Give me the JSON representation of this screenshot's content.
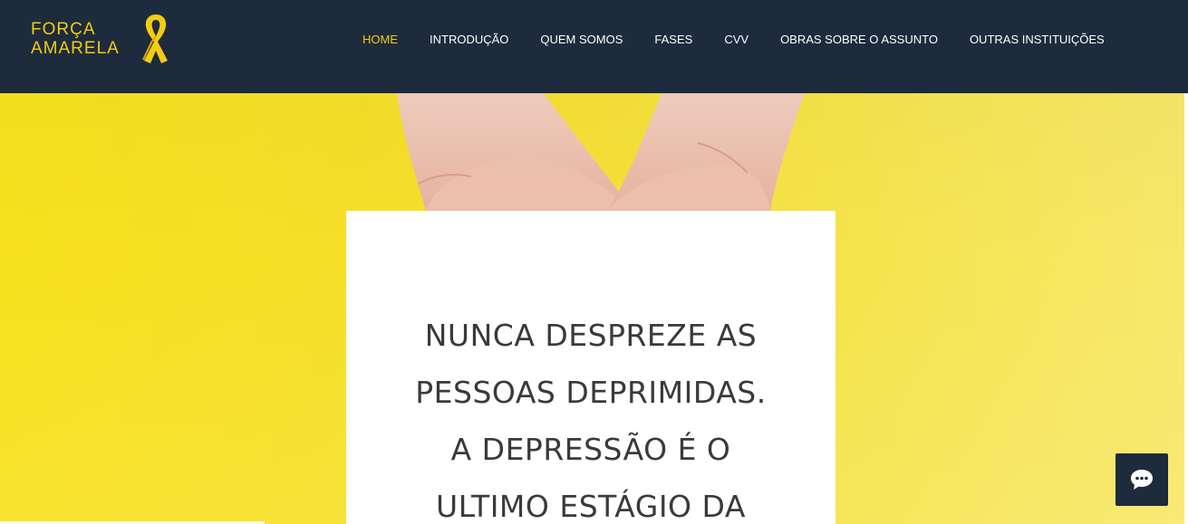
{
  "site": {
    "logo_line1": "FORÇA",
    "logo_line2": "AMARELA",
    "logo_icon": "yellow-ribbon-icon"
  },
  "nav": {
    "items": [
      {
        "label": "HOME",
        "active": true
      },
      {
        "label": "INTRODUÇÃO",
        "active": false
      },
      {
        "label": "QUEM SOMOS",
        "active": false
      },
      {
        "label": "FASES",
        "active": false
      },
      {
        "label": "CVV",
        "active": false
      },
      {
        "label": "OBRAS SOBRE O ASSUNTO",
        "active": false
      },
      {
        "label": "OUTRAS INSTITUIÇÕES",
        "active": false
      }
    ]
  },
  "hero": {
    "quote_lines": [
      "NUNCA DESPREZE AS",
      "PESSOAS DEPRIMIDAS.",
      "A DEPRESSÃO É O",
      "ULTIMO ESTÁGIO DA"
    ]
  },
  "chat": {
    "icon": "chat-bubble-icon"
  },
  "colors": {
    "header_bg": "#1d2b3c",
    "accent": "#f3cc12",
    "hero_yellow": "#f8e11d",
    "quote_text": "#3a3a3a"
  }
}
